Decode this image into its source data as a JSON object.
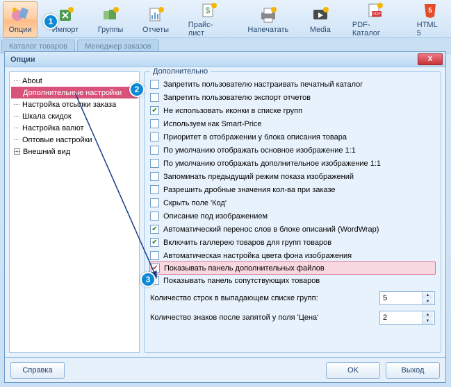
{
  "toolbar": [
    {
      "name": "options",
      "label": "Опции",
      "active": true
    },
    {
      "name": "import",
      "label": "Импорт"
    },
    {
      "name": "groups",
      "label": "Группы"
    },
    {
      "name": "reports",
      "label": "Отчеты"
    },
    {
      "name": "pricelist",
      "label": "Прайс-лист"
    },
    {
      "name": "print",
      "label": "Напечатать"
    },
    {
      "name": "media",
      "label": "Media"
    },
    {
      "name": "pdf",
      "label": "PDF-Каталог"
    },
    {
      "name": "html5",
      "label": "HTML 5"
    }
  ],
  "tabs": [
    {
      "name": "catalog",
      "label": "Каталог товаров",
      "active": false
    },
    {
      "name": "orders",
      "label": "Менеджер заказов",
      "active": false
    }
  ],
  "dialog": {
    "title": "Опции",
    "close": "X",
    "tree": [
      {
        "label": "About"
      },
      {
        "label": "Дополнительные настройки",
        "selected": true
      },
      {
        "label": "Настройка отсылки заказа"
      },
      {
        "label": "Шкала скидок"
      },
      {
        "label": "Настройка валют"
      },
      {
        "label": "Оптовые настройки"
      },
      {
        "label": "Внешний вид",
        "expander": true
      }
    ],
    "group_title": "Дополнительно",
    "options": [
      {
        "label": "Запретить пользователю настраивать печатный каталог",
        "checked": false
      },
      {
        "label": "Запретить пользователю экспорт отчетов",
        "checked": false
      },
      {
        "label": "Не использовать иконки в списке групп",
        "checked": true
      },
      {
        "label": "Используем как Smart-Price",
        "checked": false
      },
      {
        "label": "Приоритет в отображении у блока описания товара",
        "checked": false
      },
      {
        "label": "По умолчанию отображать основное изображение 1:1",
        "checked": false
      },
      {
        "label": "По умолчанию отображать дополнительное изображение 1:1",
        "checked": false
      },
      {
        "label": "Запоминать предыдущий режим показа изображений",
        "checked": false
      },
      {
        "label": "Разрешить дробные значения кол-ва при заказе",
        "checked": false
      },
      {
        "label": "Скрыть поле 'Код'",
        "checked": false
      },
      {
        "label": "Описание под изображением",
        "checked": false
      },
      {
        "label": "Автоматический перенос слов в блоке описаний (WordWrap)",
        "checked": true
      },
      {
        "label": "Включить галлерею товаров для групп товаров",
        "checked": true
      },
      {
        "label": "Автоматическая настройка цвета фона изображения",
        "checked": false
      },
      {
        "label": "Показывать панель дополнительных файлов",
        "checked": true,
        "hl": true
      },
      {
        "label": "Показывать панель сопутствующих товаров",
        "checked": true
      }
    ],
    "spins": [
      {
        "label": "Количество строк в выпадающем списке групп:",
        "value": "5"
      },
      {
        "label": "Количество знаков после запятой у поля 'Цена'",
        "value": "2"
      }
    ],
    "buttons": {
      "help": "Справка",
      "ok": "OK",
      "exit": "Выход"
    }
  },
  "steps": [
    "1",
    "2",
    "3"
  ],
  "icons": {
    "options_color": "#D95E8A",
    "star": "#F2B705"
  }
}
